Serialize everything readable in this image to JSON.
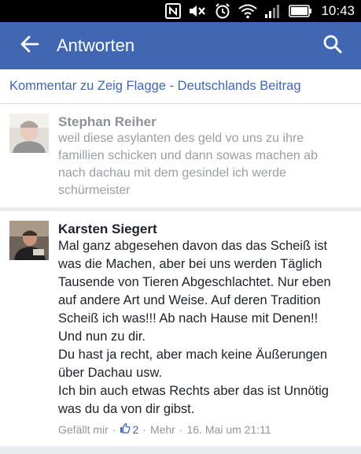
{
  "status_bar": {
    "time": "10:43",
    "icons": [
      "nfc-icon",
      "mute-icon",
      "alarm-icon",
      "wifi-icon",
      "signal-icon",
      "battery-icon"
    ]
  },
  "app_bar": {
    "title": "Antworten",
    "back_icon": "arrow-left-icon",
    "search_icon": "search-icon",
    "color": "#4267b2"
  },
  "context": {
    "text": "Kommentar zu Zeig Flagge - Deutschlands Beitrag",
    "link_color": "#4267b2"
  },
  "comments": [
    {
      "author": "Stephan Reiher",
      "lines": [
        "weil diese asylanten des geld vo uns zu ihre",
        "famillien schicken und dann sowas machen ab",
        "nach dachau mit dem gesindel ich werde",
        "schürmeister"
      ]
    },
    {
      "author": "Karsten Siegert",
      "lines": [
        "Mal ganz abgesehen davon das das Scheiß ist",
        "was die Machen, aber bei uns werden Täglich",
        "Tausende von Tieren Abgeschlachtet. Nur eben",
        "auf andere Art und Weise. Auf deren Tradition",
        "Scheiß ich was!!! Ab nach Hause mit Denen!!",
        "Und nun zu dir.",
        "Du hast ja recht, aber mach keine Äußerungen",
        "über Dachau usw.",
        "Ich bin auch etwas Rechts aber das ist Unnötig",
        "was du da von dir gibst."
      ],
      "actions": {
        "like": "Gefällt mir",
        "separator": "·",
        "like_count": "2",
        "more": "Mehr",
        "timestamp": "16. Mai um 21:11"
      }
    }
  ]
}
